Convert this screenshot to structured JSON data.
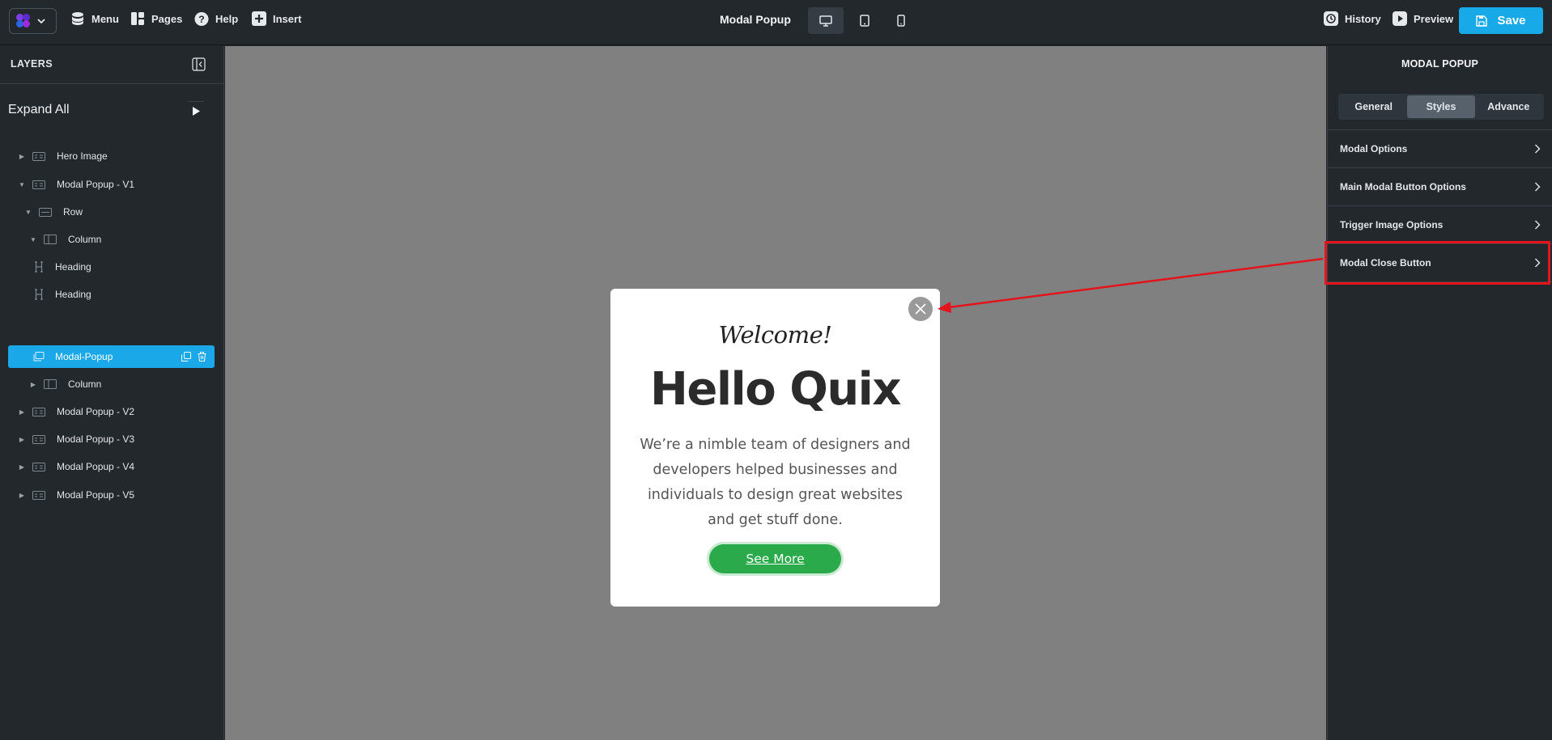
{
  "topbar": {
    "menu_label": "Menu",
    "pages_label": "Pages",
    "help_label": "Help",
    "insert_label": "Insert",
    "page_title": "Modal Popup",
    "history_label": "History",
    "preview_label": "Preview",
    "save_label": "Save",
    "accent_color": "#18a9e8"
  },
  "layers": {
    "title": "LAYERS",
    "expand_all": "Expand All",
    "items": [
      {
        "label": "Hero Image",
        "icon": "section-icon",
        "state": "collapsed"
      },
      {
        "label": "Modal Popup - V1",
        "icon": "section-icon",
        "state": "expanded"
      },
      {
        "label": "Row",
        "icon": "row-icon",
        "state": "expanded"
      },
      {
        "label": "Column",
        "icon": "column-icon",
        "state": "expanded"
      },
      {
        "label": "Heading",
        "icon": "heading-icon",
        "state": "leaf"
      },
      {
        "label": "Heading",
        "icon": "heading-icon",
        "state": "leaf"
      },
      {
        "label": "Modal-Popup",
        "icon": "modal-icon",
        "state": "selected"
      },
      {
        "label": "Column",
        "icon": "column-icon",
        "state": "collapsed"
      },
      {
        "label": "Modal Popup - V2",
        "icon": "section-icon",
        "state": "collapsed"
      },
      {
        "label": "Modal Popup - V3",
        "icon": "section-icon",
        "state": "collapsed"
      },
      {
        "label": "Modal Popup - V4",
        "icon": "section-icon",
        "state": "collapsed"
      },
      {
        "label": "Modal Popup - V5",
        "icon": "section-icon",
        "state": "collapsed"
      }
    ]
  },
  "modal": {
    "welcome": "Welcome!",
    "heading": "Hello Quix",
    "body": "We’re a nimble team of designers and developers helped businesses and individuals to design great websites and get stuff done.",
    "button_label": "See More",
    "button_color": "#2aaa4a"
  },
  "props": {
    "title": "MODAL POPUP",
    "tabs": [
      "General",
      "Styles",
      "Advance"
    ],
    "active_tab": "Styles",
    "sections": [
      "Modal Options",
      "Main Modal Button Options",
      "Trigger Image Options",
      "Modal Close Button"
    ],
    "highlighted_section": "Modal Close Button",
    "highlight_color": "#e3141b"
  }
}
